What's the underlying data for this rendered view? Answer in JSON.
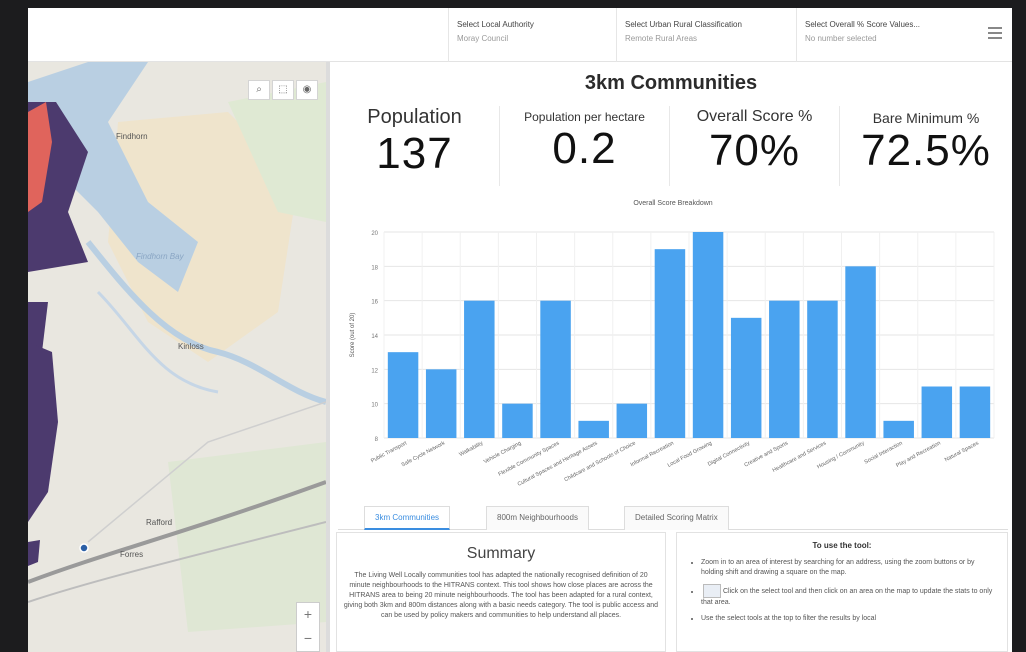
{
  "header": {
    "filters": [
      {
        "label": "Select Local Authority",
        "value": "Moray Council"
      },
      {
        "label": "Select Urban Rural Classification",
        "value": "Remote Rural Areas"
      },
      {
        "label": "Select Overall % Score Values...",
        "value": "No number selected"
      }
    ],
    "menu_icon": "hamburger-icon"
  },
  "map": {
    "tools": [
      {
        "icon": "search-icon",
        "glyph": "⌕"
      },
      {
        "icon": "select-icon",
        "glyph": "⬚"
      },
      {
        "icon": "layers-icon",
        "glyph": "◉"
      }
    ],
    "labels": [
      {
        "text": "Findhorn",
        "kind": "place"
      },
      {
        "text": "Findhorn Bay",
        "kind": "water"
      },
      {
        "text": "Kinloss",
        "kind": "place"
      },
      {
        "text": "Forres",
        "kind": "place"
      },
      {
        "text": "Rafford",
        "kind": "place"
      }
    ],
    "zoom_in": "+",
    "zoom_out": "−"
  },
  "dashboard": {
    "title": "3km Communities",
    "kpis": [
      {
        "label": "Population",
        "value": "137"
      },
      {
        "label": "Population per hectare",
        "value": "0.2"
      },
      {
        "label": "Overall Score %",
        "value": "70%"
      },
      {
        "label": "Bare Minimum %",
        "value": "72.5%"
      }
    ]
  },
  "chart_data": {
    "type": "bar",
    "title": "Overall Score Breakdown",
    "ylabel": "Score (out of 20)",
    "ylim": [
      8,
      20
    ],
    "yticks": [
      8,
      10,
      12,
      14,
      16,
      18,
      20
    ],
    "color": "#4aa3f0",
    "categories": [
      "Public Transport",
      "Safe Cycle Network",
      "Walkability",
      "Vehicle Charging",
      "Flexible Community Spaces",
      "Cultural Spaces and Heritage Assets",
      "Childcare and Schools of Choice",
      "Informal Recreation",
      "Local Food Growing",
      "Digital Connectivity",
      "Creative and Sports",
      "Healthcare and Services",
      "Housing / Community",
      "Social Interaction",
      "Play and Recreation",
      "Natural Spaces"
    ],
    "values": [
      13,
      12,
      16,
      10,
      16,
      9,
      10,
      19,
      20,
      15,
      16,
      16,
      18,
      9,
      11,
      11
    ]
  },
  "tabs": [
    {
      "label": "3km Communities",
      "active": true
    },
    {
      "label": "800m Neighbourhoods",
      "active": false
    },
    {
      "label": "Detailed Scoring Matrix",
      "active": false
    }
  ],
  "summary": {
    "title": "Summary",
    "body": "The Living Well Locally communities tool has adapted the nationally recognised definition of 20 minute neighbourhoods to the HITRANS context. This tool shows how close places are across the HITRANS area to being 20 minute neighbourhoods. The tool has been adapted for a rural context, giving both 3km and 800m distances along with a basic needs category. The tool is public access and can be used by policy makers and communities to help understand all places."
  },
  "howto": {
    "title": "To use the tool:",
    "items": [
      "Zoom in to an area of interest by searching for an address, using the zoom buttons or by holding shift and drawing a square on the map.",
      "Click on the select tool and then click on an area on the map to update the stats to only that area.",
      "Use the select tools at the top to filter the results by local"
    ]
  }
}
